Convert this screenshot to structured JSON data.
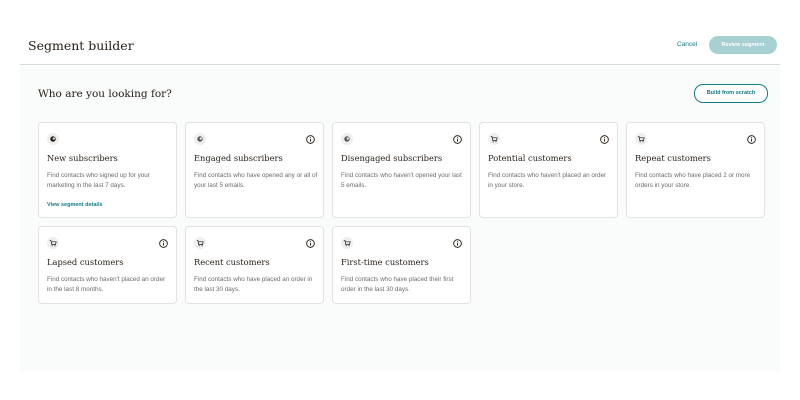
{
  "header": {
    "title": "Segment builder",
    "cancel_label": "Cancel",
    "review_label": "Review segment"
  },
  "main": {
    "heading": "Who are you looking for?",
    "build_from_scratch_label": "Build from scratch"
  },
  "segments": [
    {
      "icon": "mailchimp-logo-icon",
      "title": "New subscribers",
      "description": "Find contacts who signed up for your marketing in the last 7 days.",
      "link": "View segment details",
      "has_info": false
    },
    {
      "icon": "mailchimp-logo-icon",
      "title": "Engaged subscribers",
      "description": "Find contacts who have opened any or all of your last 5 emails.",
      "has_info": true
    },
    {
      "icon": "mailchimp-logo-icon",
      "title": "Disengaged subscribers",
      "description": "Find contacts who haven't opened your last 5 emails.",
      "has_info": true
    },
    {
      "icon": "shopping-cart-icon",
      "title": "Potential customers",
      "description": "Find contacts who haven't placed an order in your store.",
      "has_info": true
    },
    {
      "icon": "shopping-cart-icon",
      "title": "Repeat customers",
      "description": "Find contacts who have placed 2 or more orders in your store.",
      "has_info": true
    },
    {
      "icon": "shopping-cart-icon",
      "title": "Lapsed customers",
      "description": "Find contacts who haven't placed an order in the last 8 months.",
      "has_info": true
    },
    {
      "icon": "shopping-cart-icon",
      "title": "Recent customers",
      "description": "Find contacts who have placed an order in the last 30 days.",
      "has_info": true
    },
    {
      "icon": "shopping-cart-icon",
      "title": "First-time customers",
      "description": "Find contacts who have placed their first order in the last 30 days.",
      "has_info": true
    }
  ],
  "colors": {
    "accent": "#0f7b84",
    "review_button_bg": "#a6d0d2",
    "page_bg": "#fafbfb"
  }
}
